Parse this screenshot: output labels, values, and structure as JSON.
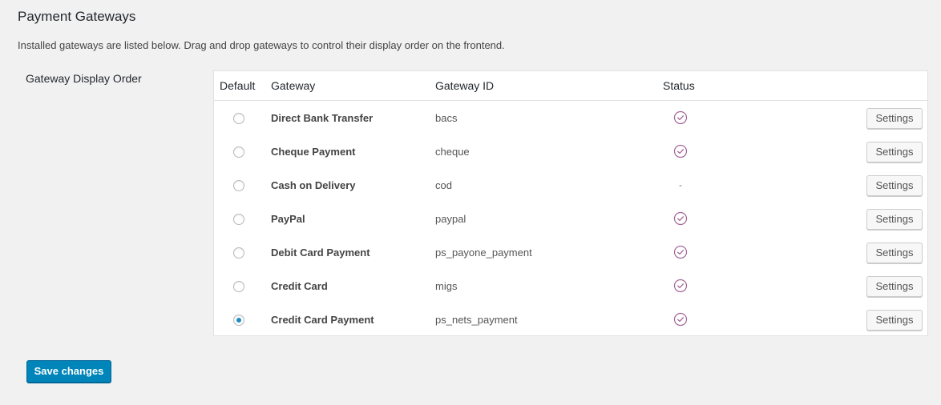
{
  "page": {
    "title": "Payment Gateways",
    "description": "Installed gateways are listed below. Drag and drop gateways to control their display order on the frontend.",
    "row_label": "Gateway Display Order"
  },
  "table": {
    "headers": {
      "default": "Default",
      "gateway": "Gateway",
      "gateway_id": "Gateway ID",
      "status": "Status"
    },
    "rows": [
      {
        "name": "Direct Bank Transfer",
        "id": "bacs",
        "enabled": true,
        "status_text": "",
        "is_default": false,
        "settings_label": "Settings"
      },
      {
        "name": "Cheque Payment",
        "id": "cheque",
        "enabled": true,
        "status_text": "",
        "is_default": false,
        "settings_label": "Settings"
      },
      {
        "name": "Cash on Delivery",
        "id": "cod",
        "enabled": false,
        "status_text": "-",
        "is_default": false,
        "settings_label": "Settings"
      },
      {
        "name": "PayPal",
        "id": "paypal",
        "enabled": true,
        "status_text": "",
        "is_default": false,
        "settings_label": "Settings"
      },
      {
        "name": "Debit Card Payment",
        "id": "ps_payone_payment",
        "enabled": true,
        "status_text": "",
        "is_default": false,
        "settings_label": "Settings"
      },
      {
        "name": "Credit Card",
        "id": "migs",
        "enabled": true,
        "status_text": "",
        "is_default": false,
        "settings_label": "Settings"
      },
      {
        "name": "Credit Card Payment",
        "id": "ps_nets_payment",
        "enabled": true,
        "status_text": "",
        "is_default": true,
        "settings_label": "Settings"
      }
    ]
  },
  "actions": {
    "save_label": "Save changes"
  },
  "icons": {
    "status_enabled": "check-circle-icon"
  },
  "colors": {
    "primary_button": "#0085ba",
    "status_check": "#a46497",
    "radio_dot": "#1e8cbe",
    "background": "#f1f1f1"
  }
}
